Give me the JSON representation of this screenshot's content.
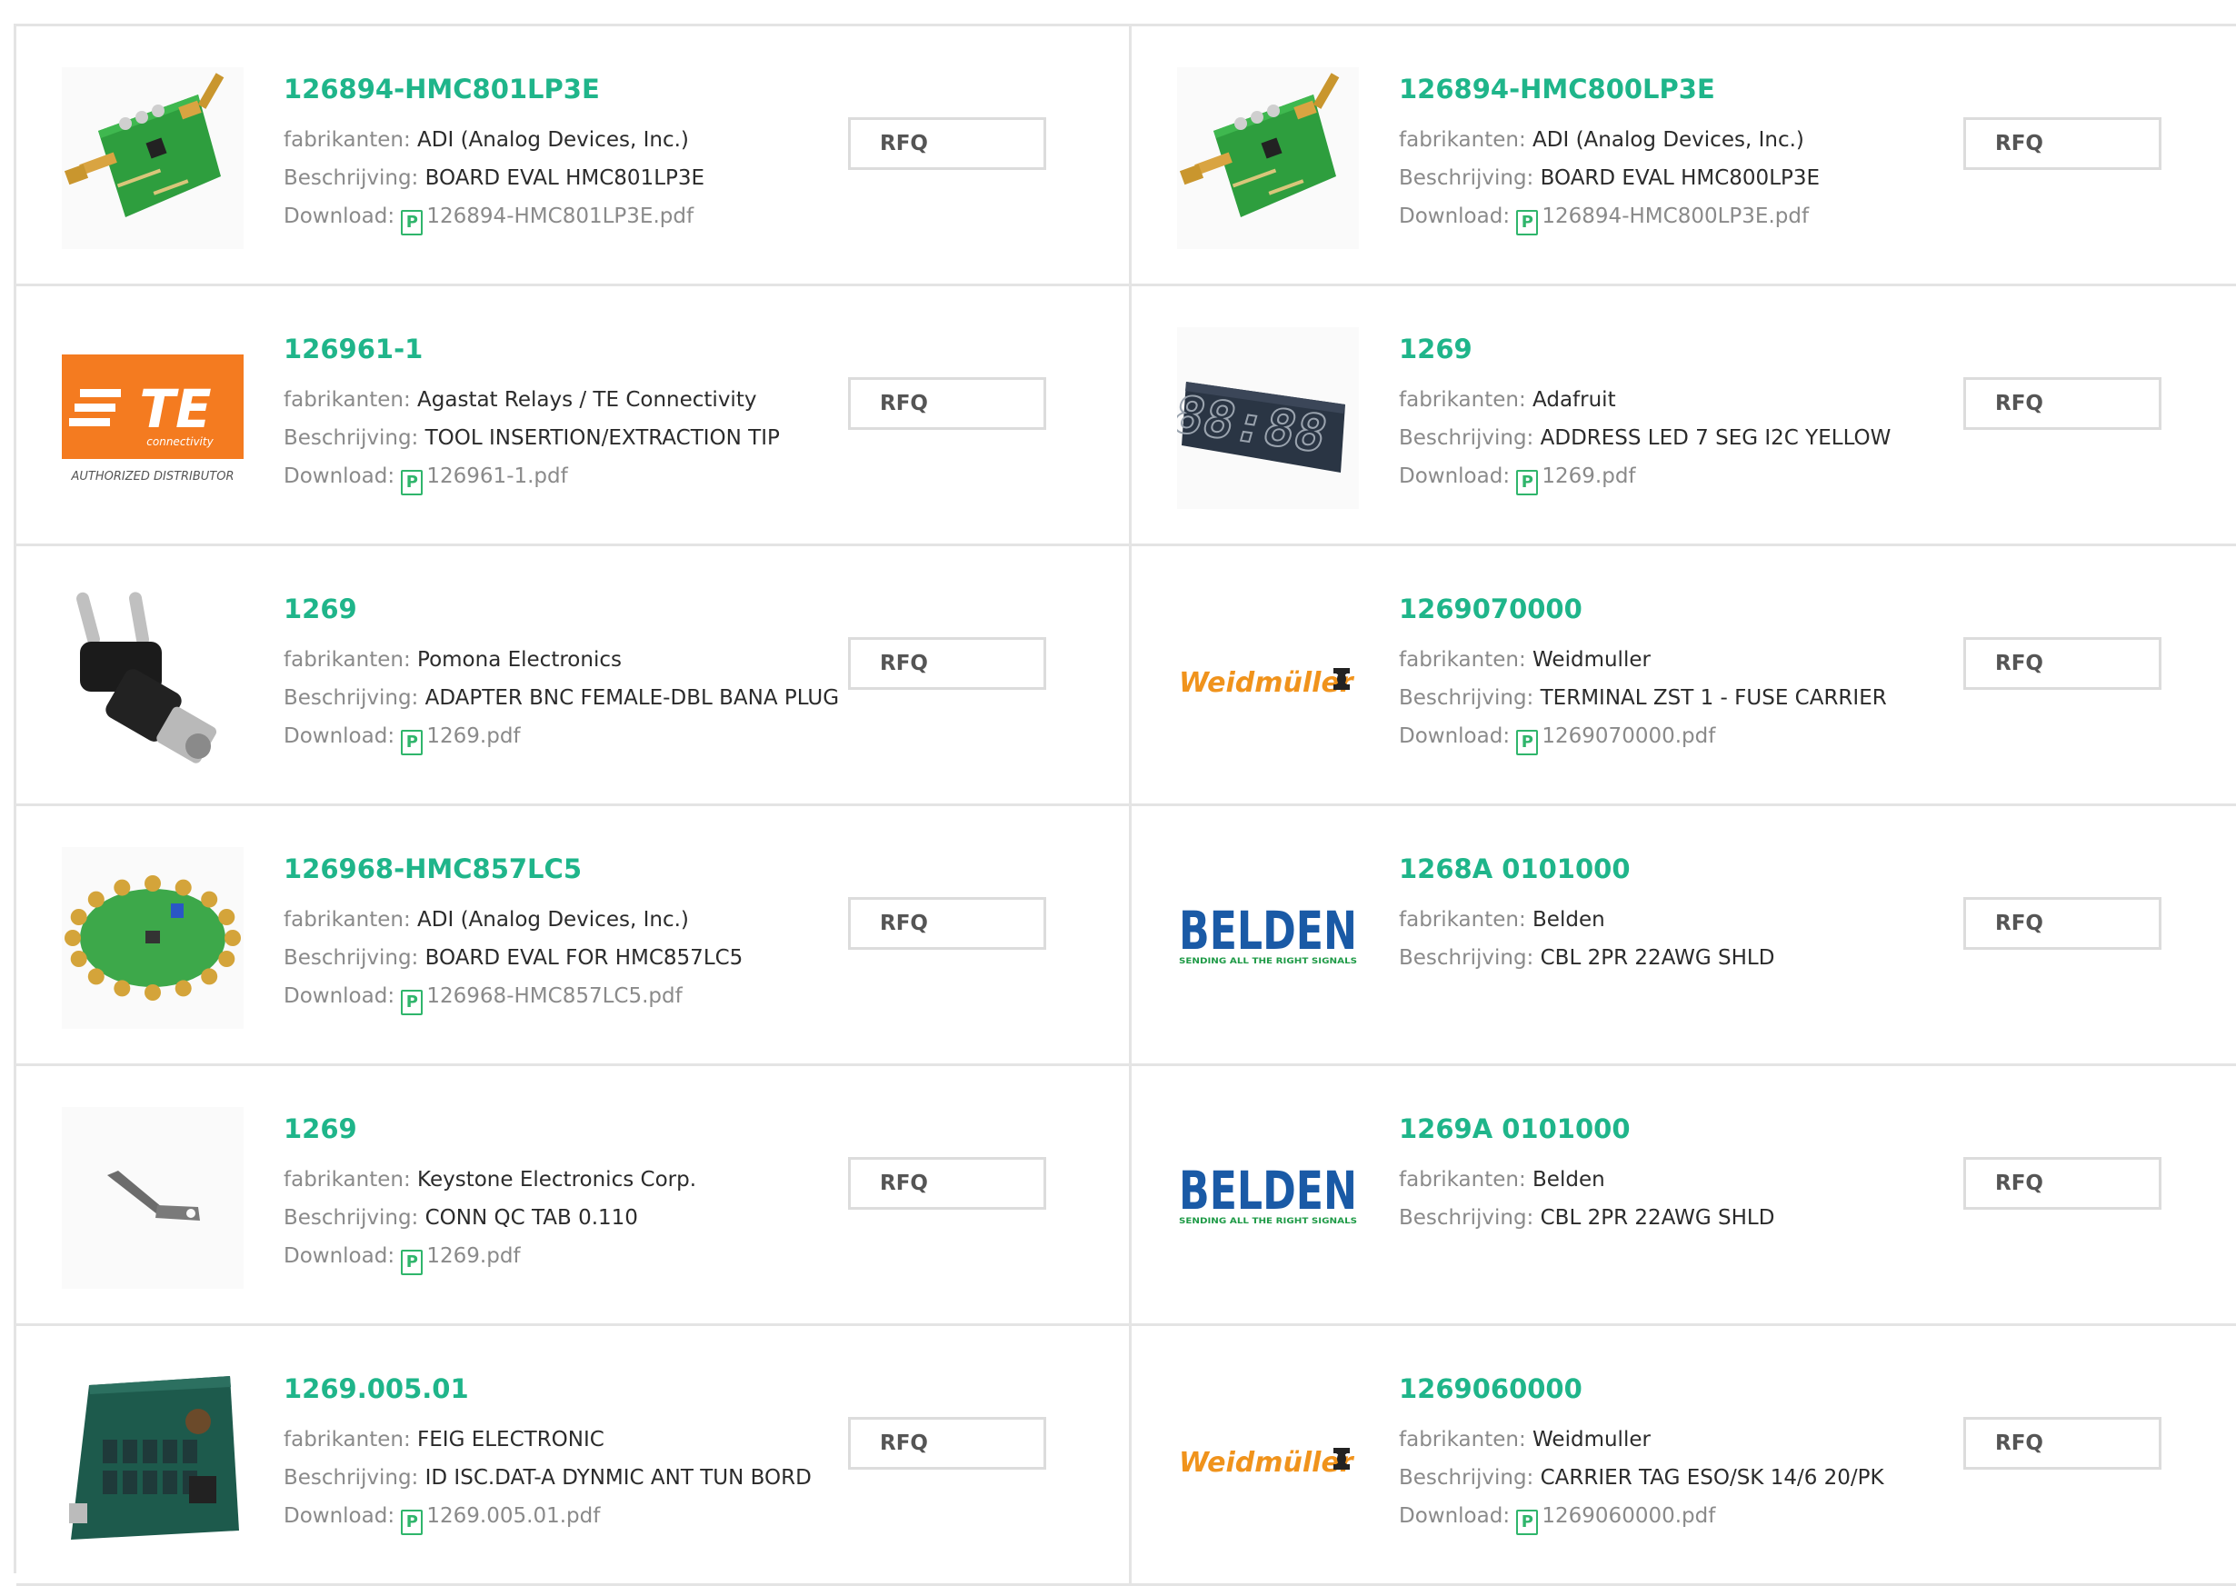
{
  "labels": {
    "manufacturer": "fabrikanten:",
    "description": "Beschrijving:",
    "download": "Download:",
    "rfq": "RFQ",
    "pdf_icon": "P"
  },
  "colors": {
    "accent": "#1fb58a",
    "pdf": "#2fb56b",
    "border": "#e4e4e4"
  },
  "products": [
    {
      "part": "126894-HMC801LP3E",
      "manufacturer": "ADI (Analog Devices, Inc.)",
      "description": "BOARD EVAL HMC801LP3E",
      "download": "126894-HMC801LP3E.pdf",
      "image": "eval-board-icon"
    },
    {
      "part": "126894-HMC800LP3E",
      "manufacturer": "ADI (Analog Devices, Inc.)",
      "description": "BOARD EVAL HMC800LP3E",
      "download": "126894-HMC800LP3E.pdf",
      "image": "eval-board-icon"
    },
    {
      "part": "126961-1",
      "manufacturer": "Agastat Relays / TE Connectivity",
      "description": "TOOL INSERTION/EXTRACTION TIP",
      "download": "126961-1.pdf",
      "image": "te-logo",
      "logo": {
        "main": "TE",
        "sub": "connectivity",
        "caption": "AUTHORIZED DISTRIBUTOR"
      }
    },
    {
      "part": "1269",
      "manufacturer": "Adafruit",
      "description": "ADDRESS LED 7 SEG I2C YELLOW",
      "download": "1269.pdf",
      "image": "seven-segment-display-icon",
      "display_text": "88:88"
    },
    {
      "part": "1269",
      "manufacturer": "Pomona Electronics",
      "description": "ADAPTER BNC FEMALE-DBL BANA PLUG",
      "download": "1269.pdf",
      "image": "bnc-adapter-icon"
    },
    {
      "part": "1269070000",
      "manufacturer": "Weidmuller",
      "description": "TERMINAL ZST 1 - FUSE CARRIER",
      "download": "1269070000.pdf",
      "image": "weidmuller-logo",
      "logo": {
        "main": "Weidmüller"
      }
    },
    {
      "part": "126968-HMC857LC5",
      "manufacturer": "ADI (Analog Devices, Inc.)",
      "description": "BOARD EVAL FOR HMC857LC5",
      "download": "126968-HMC857LC5.pdf",
      "image": "round-board-icon"
    },
    {
      "part": "1268A 0101000",
      "manufacturer": "Belden",
      "description": "CBL 2PR 22AWG SHLD",
      "image": "belden-logo",
      "logo": {
        "main": "BELDEN",
        "sub": "SENDING ALL THE RIGHT SIGNALS"
      }
    },
    {
      "part": "1269",
      "manufacturer": "Keystone Electronics Corp.",
      "description": "CONN QC TAB 0.110",
      "download": "1269.pdf",
      "image": "qc-tab-icon"
    },
    {
      "part": "1269A 0101000",
      "manufacturer": "Belden",
      "description": "CBL 2PR 22AWG SHLD",
      "image": "belden-logo",
      "logo": {
        "main": "BELDEN",
        "sub": "SENDING ALL THE RIGHT SIGNALS"
      }
    },
    {
      "part": "1269.005.01",
      "manufacturer": "FEIG ELECTRONIC",
      "description": "ID ISC.DAT-A DYNMIC ANT TUN BORD",
      "download": "1269.005.01.pdf",
      "image": "pcb-board-icon"
    },
    {
      "part": "1269060000",
      "manufacturer": "Weidmuller",
      "description": "CARRIER TAG ESO/SK 14/6 20/PK",
      "download": "1269060000.pdf",
      "image": "weidmuller-logo",
      "logo": {
        "main": "Weidmüller"
      }
    }
  ]
}
